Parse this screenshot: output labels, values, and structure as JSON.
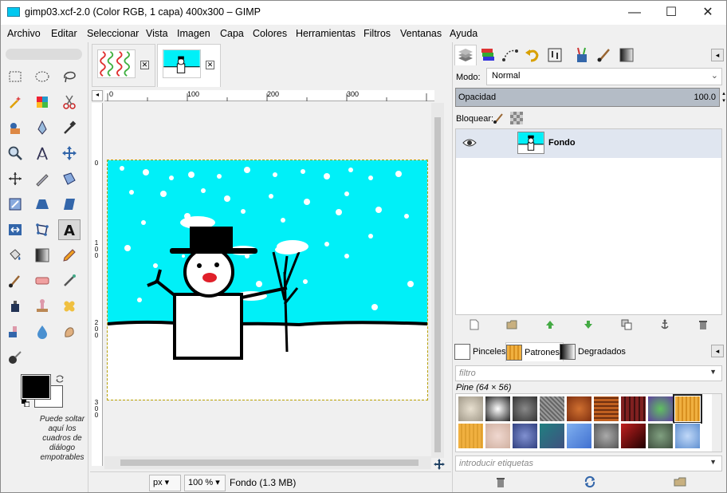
{
  "window": {
    "title": "gimp03.xcf-2.0 (Color RGB, 1 capa) 400x300 – GIMP",
    "minimize": "—",
    "maximize": "☐",
    "close": "✕"
  },
  "menu": [
    "Archivo",
    "Editar",
    "Seleccionar",
    "Vista",
    "Imagen",
    "Capa",
    "Colores",
    "Herramientas",
    "Filtros",
    "Ventanas",
    "Ayuda"
  ],
  "toolbox": {
    "tools": [
      "rect-select",
      "ellipse-select",
      "free-select",
      "fuzzy-select",
      "select-by-color",
      "scissors-select",
      "foreground-select",
      "paths",
      "color-picker",
      "zoom",
      "measure",
      "move",
      "align",
      "crop",
      "unified-transform",
      "rotate",
      "scale",
      "shear",
      "flip",
      "cage-transform",
      "text",
      "bucket-fill",
      "blend",
      "pencil",
      "paintbrush",
      "eraser",
      "airbrush",
      "ink",
      "clone",
      "heal",
      "perspective-clone",
      "blur-sharpen",
      "smudge",
      "dodge-burn"
    ],
    "active_tool": "text",
    "fg_color": "#000000",
    "bg_color": "#ffffff",
    "drop_note": "Puede soltar aquí los cuadros de diálogo empotrables"
  },
  "image_tabs": [
    {
      "name": "pattern-image",
      "active": false,
      "close": "✕"
    },
    {
      "name": "snowman-image",
      "active": true,
      "close": "✕"
    }
  ],
  "rulers": {
    "h_ticks": [
      "0",
      "100",
      "200",
      "300"
    ],
    "v_ticks": [
      "0",
      "1 0 0",
      "2 0 0",
      "3 0 0"
    ]
  },
  "statusbar": {
    "unit": "px",
    "zoom": "100 %",
    "info": "Fondo (1.3 MB)"
  },
  "layers_panel": {
    "mode_label": "Modo:",
    "mode_value": "Normal",
    "opacity_label": "Opacidad",
    "opacity_value": "100.0",
    "lock_label": "Bloquear:",
    "layers": [
      {
        "name": "Fondo",
        "visible": true
      }
    ]
  },
  "brushes_panel": {
    "tabs": [
      "Pinceles",
      "Patrones",
      "Degradados"
    ],
    "active_tab": "Patrones",
    "filter_placeholder": "filtro",
    "selected_pattern": "Pine (64 × 56)",
    "tags_placeholder": "introducir etiquetas"
  },
  "colors": {
    "sky": "#00f0f8",
    "snow": "#ffffff",
    "hat": "#000000",
    "nose": "#e0202a",
    "layer_highlight": "#e0e6f0"
  }
}
